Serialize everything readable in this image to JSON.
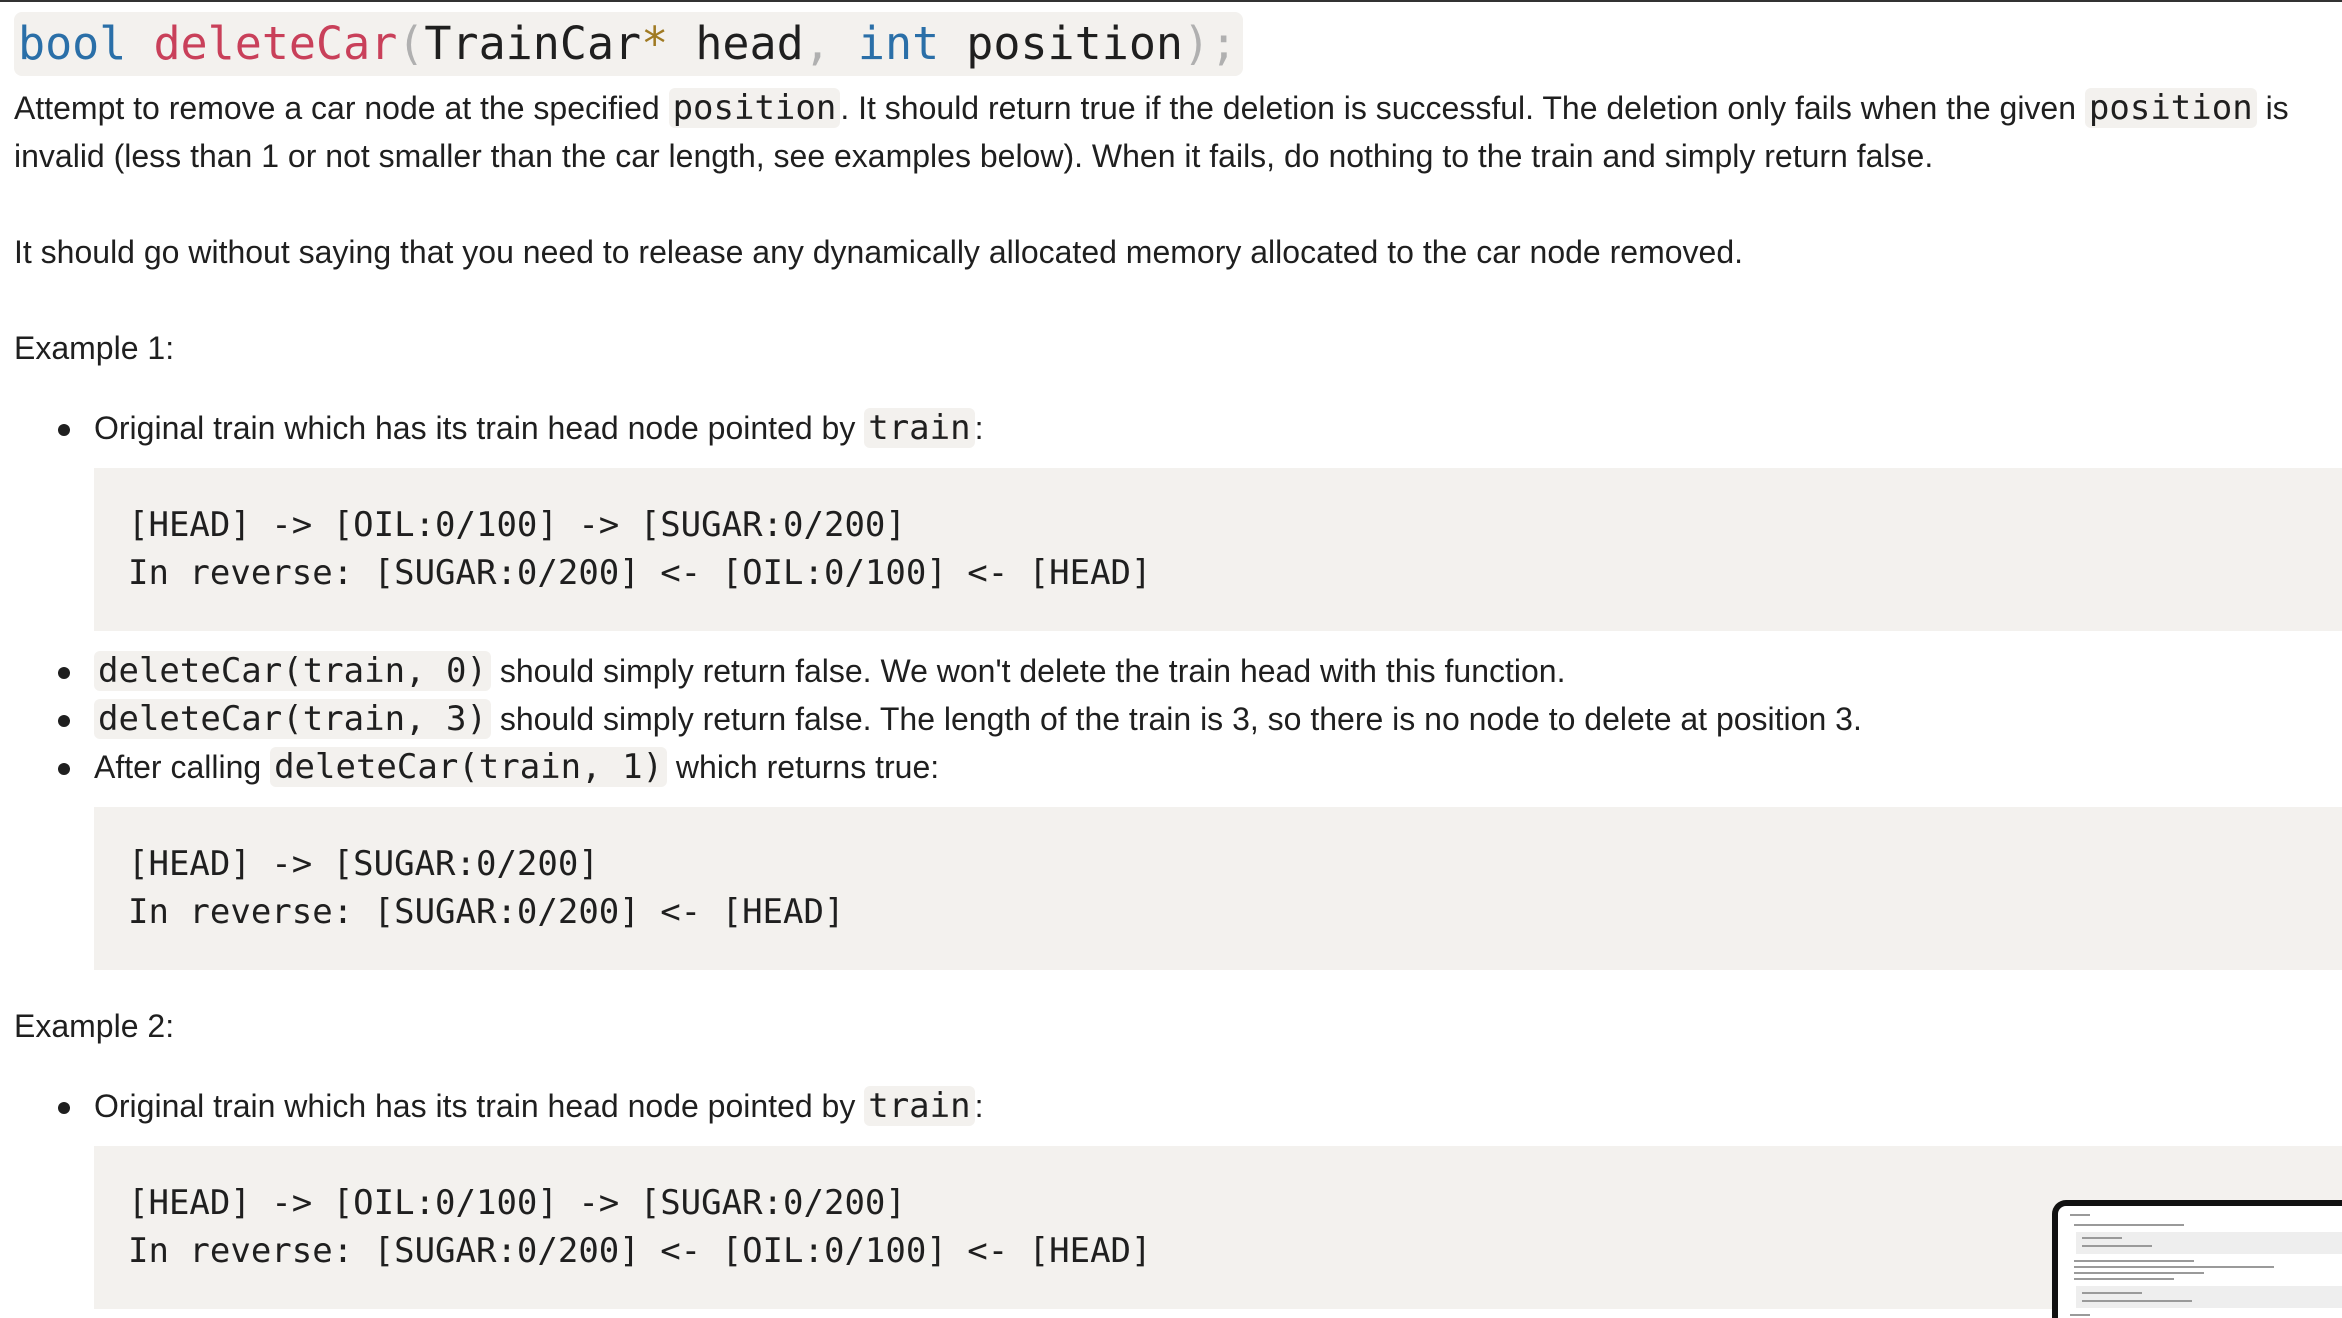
{
  "signature": {
    "ret_type": "bool",
    "fn_name": "deleteCar",
    "open_paren": "(",
    "param1_type": "TrainCar",
    "ptr": "*",
    "param1_name": " head",
    "comma": ",",
    "param2_type": " int",
    "param2_name": " position",
    "close": ");"
  },
  "description": {
    "p1_a": "Attempt to remove a car node at the specified ",
    "p1_code": "position",
    "p1_b": ". It should return true if the deletion is successful. The deletion only fails when the given ",
    "p1_code2": "position",
    "p1_c": " is invalid (less than 1 or not smaller than the car length, see examples below). When it fails, do nothing to the train and simply return false.",
    "p2": "It should go without saying that you need to release any dynamically allocated memory allocated to the car node removed."
  },
  "example1": {
    "heading": "Example 1:",
    "bullet1_text": "Original train which has its train head node pointed by ",
    "bullet1_code": "train",
    "bullet1_tail": ":",
    "code1_line1": "[HEAD] -> [OIL:0/100] -> [SUGAR:0/200]",
    "code1_line2": "In reverse: [SUGAR:0/200] <- [OIL:0/100] <- [HEAD]",
    "bullet2_code": "deleteCar(train, 0)",
    "bullet2_text": " should simply return false. We won't delete the train head with this function.",
    "bullet3_code": "deleteCar(train, 3)",
    "bullet3_text": " should simply return false. The length of the train is 3, so there is no node to delete at position 3.",
    "bullet4_a": "After calling ",
    "bullet4_code": "deleteCar(train, 1)",
    "bullet4_b": " which returns true:",
    "code2_line1": "[HEAD] -> [SUGAR:0/200]",
    "code2_line2": "In reverse: [SUGAR:0/200] <- [HEAD]"
  },
  "example2": {
    "heading": "Example 2:",
    "bullet1_text": "Original train which has its train head node pointed by ",
    "bullet1_code": "train",
    "bullet1_tail": ":",
    "code1_line1": "[HEAD] -> [OIL:0/100] -> [SUGAR:0/200]",
    "code1_line2": "In reverse: [SUGAR:0/200] <- [OIL:0/100] <- [HEAD]"
  },
  "colors": {
    "keyword": "#2a6fa8",
    "function_name": "#c9405a",
    "code_background": "#f3f1ee"
  }
}
